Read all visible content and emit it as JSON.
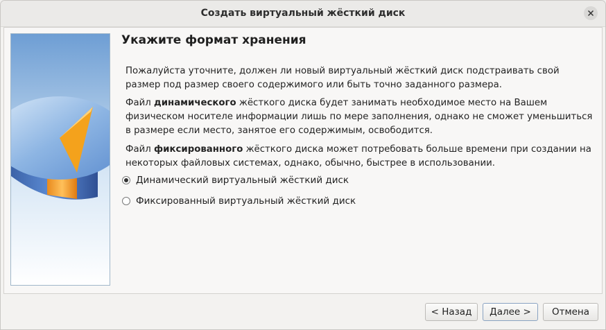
{
  "window": {
    "title": "Создать виртуальный жёсткий диск"
  },
  "page": {
    "heading": "Укажите формат хранения",
    "intro": "Пожалуйста уточните, должен ли новый виртуальный жёсткий диск подстраивать свой размер под размер своего содержимого или быть точно заданного размера.",
    "dynamic_desc": {
      "prefix": "Файл ",
      "bold": "динамического",
      "suffix": " жёсткого диска будет занимать необходимое место на Вашем физическом носителе информации лишь по мере заполнения, однако не сможет уменьшиться в размере если место, занятое его содержимым, освободится."
    },
    "fixed_desc": {
      "prefix": "Файл ",
      "bold": "фиксированного",
      "suffix": " жёсткого диска может потребовать больше времени при создании на некоторых файловых системах, однако, обычно, быстрее в использовании."
    },
    "options": [
      {
        "label": "Динамический виртуальный жёсткий диск",
        "selected": true
      },
      {
        "label": "Фиксированный виртуальный жёсткий диск",
        "selected": false
      }
    ]
  },
  "buttons": {
    "back": "< Назад",
    "next": "Далее >",
    "cancel": "Отмена"
  }
}
